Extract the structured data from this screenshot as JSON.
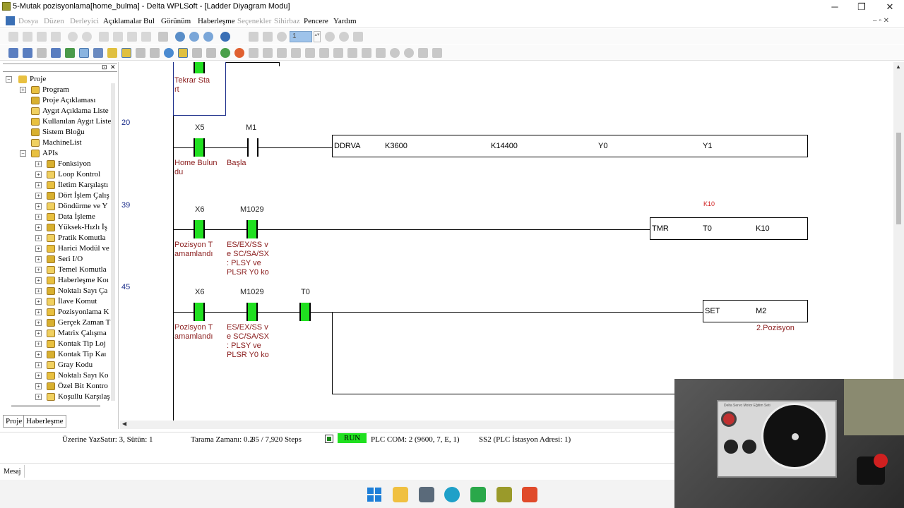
{
  "window": {
    "title": "5-Mutak pozisyonlama[home_bulma] - Delta WPLSoft - [Ladder Diyagram Modu]",
    "minimize": "─",
    "maximize": "❐",
    "close": "✕"
  },
  "menu": {
    "items": [
      {
        "label": "Dosya",
        "enabled": false
      },
      {
        "label": "Düzen",
        "enabled": false
      },
      {
        "label": "Derleyici",
        "enabled": false
      },
      {
        "label": "Açıklamalar",
        "enabled": true
      },
      {
        "label": "Bul",
        "enabled": true
      },
      {
        "label": "Görünüm",
        "enabled": true
      },
      {
        "label": "Haberleşme",
        "enabled": true
      },
      {
        "label": "Seçenekler",
        "enabled": false
      },
      {
        "label": "Sihirbaz",
        "enabled": false
      },
      {
        "label": "Pencere",
        "enabled": true
      },
      {
        "label": "Yardım",
        "enabled": true
      }
    ],
    "mdi_controls": "– ▫ ✕"
  },
  "toolbar": {
    "page_field": "1"
  },
  "tree": {
    "root": "Proje",
    "items": [
      {
        "label": "Program",
        "level": 1,
        "exp": "+"
      },
      {
        "label": "Proje Açıklaması",
        "level": 1,
        "exp": ""
      },
      {
        "label": "Aygıt Açıklama Liste",
        "level": 1,
        "exp": ""
      },
      {
        "label": "Kullanılan Aygıt Liste",
        "level": 1,
        "exp": ""
      },
      {
        "label": "Sistem Bloğu",
        "level": 1,
        "exp": ""
      },
      {
        "label": "MachineList",
        "level": 1,
        "exp": ""
      },
      {
        "label": "APIs",
        "level": 1,
        "exp": "-"
      },
      {
        "label": "Fonksiyon",
        "level": 2,
        "exp": "+"
      },
      {
        "label": "Loop Kontrol",
        "level": 2,
        "exp": "+"
      },
      {
        "label": "İletim Karşılaştı",
        "level": 2,
        "exp": "+"
      },
      {
        "label": "Dört İşlem Çalış",
        "level": 2,
        "exp": "+"
      },
      {
        "label": "Döndürme ve Y",
        "level": 2,
        "exp": "+"
      },
      {
        "label": "Data İşleme",
        "level": 2,
        "exp": "+"
      },
      {
        "label": "Yüksek-Hızlı İş",
        "level": 2,
        "exp": "+"
      },
      {
        "label": "Pratik Komutla",
        "level": 2,
        "exp": "+"
      },
      {
        "label": "Harici Modül ve",
        "level": 2,
        "exp": "+"
      },
      {
        "label": "Seri I/O",
        "level": 2,
        "exp": "+"
      },
      {
        "label": "Temel Komutla",
        "level": 2,
        "exp": "+"
      },
      {
        "label": "Haberleşme Koı",
        "level": 2,
        "exp": "+"
      },
      {
        "label": "Noktalı Sayı Ça",
        "level": 2,
        "exp": "+"
      },
      {
        "label": "İlave Komut",
        "level": 2,
        "exp": "+"
      },
      {
        "label": "Pozisyonlama K",
        "level": 2,
        "exp": "+"
      },
      {
        "label": "Gerçek Zaman T",
        "level": 2,
        "exp": "+"
      },
      {
        "label": "Matrix Çalışma",
        "level": 2,
        "exp": "+"
      },
      {
        "label": "Kontak Tip Loj",
        "level": 2,
        "exp": "+"
      },
      {
        "label": "Kontak Tip Kaı",
        "level": 2,
        "exp": "+"
      },
      {
        "label": "Gray Kodu",
        "level": 2,
        "exp": "+"
      },
      {
        "label": "Noktalı Sayı Ko",
        "level": 2,
        "exp": "+"
      },
      {
        "label": "Özel Bit Kontro",
        "level": 2,
        "exp": "+"
      },
      {
        "label": "Koşullu Karşılaş",
        "level": 2,
        "exp": "+"
      }
    ],
    "tabs": [
      "Proje",
      "Haberleşme"
    ]
  },
  "ladder": {
    "prev_comment": "Tekrar Sta\nrt",
    "rungs": [
      {
        "step": "20",
        "contacts": [
          {
            "device": "X5",
            "comment": "Home Bulun\ndu",
            "on": true
          },
          {
            "device": "M1",
            "comment": "Başla",
            "on": false
          }
        ],
        "instr": [
          "DDRVA",
          "K3600",
          "K14400",
          "Y0",
          "Y1"
        ]
      },
      {
        "step": "39",
        "contacts": [
          {
            "device": "X6",
            "comment": "Pozisyon T\namamlandı",
            "on": true
          },
          {
            "device": "M1029",
            "comment": "ES/EX/SS v\ne SC/SA/SX\n: PLSY ve\nPLSR Y0 ko",
            "on": true
          }
        ],
        "monitor": "K10",
        "instr": [
          "TMR",
          "T0",
          "K10"
        ]
      },
      {
        "step": "45",
        "contacts": [
          {
            "device": "X6",
            "comment": "Pozisyon T\namamlandı",
            "on": true
          },
          {
            "device": "M1029",
            "comment": "ES/EX/SS v\ne SC/SA/SX\n: PLSY ve\nPLSR Y0 ko",
            "on": true
          },
          {
            "device": "T0",
            "comment": "",
            "on": true
          }
        ],
        "instr": [
          "SET",
          "M2"
        ],
        "out_comment": "2.Pozisyon"
      }
    ]
  },
  "status": {
    "mode": "Üzerine Yaz",
    "position": "Satır: 3, Sütün: 1",
    "scan": "Tarama Zamanı: 0.2",
    "steps": "85 / 7,920 Steps",
    "run": "RUN",
    "com": "PLC COM: 2 (9600, 7, E, 1)",
    "station": "SS2 (PLC İstasyon Adresi: 1)"
  },
  "message": {
    "label": "Mesaj"
  },
  "webcam": {
    "caption": "Delta Servo Motor Eğitim Seti"
  }
}
